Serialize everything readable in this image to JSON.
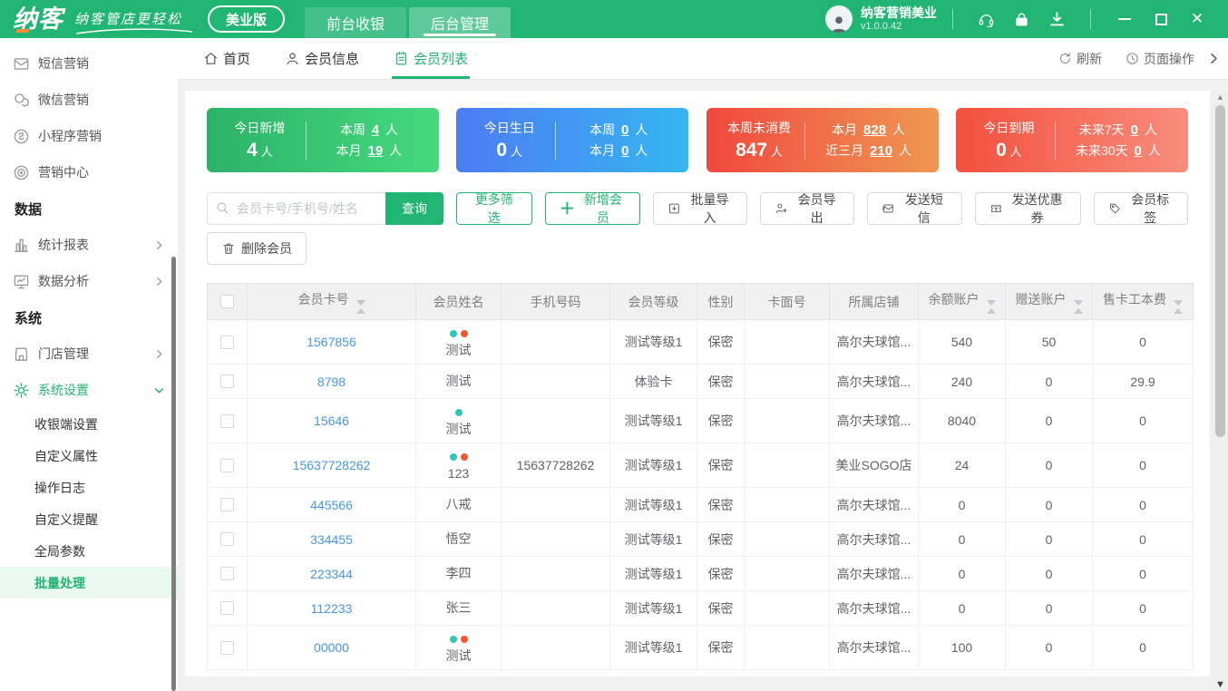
{
  "colors": {
    "brand_green": "#21b573",
    "link_blue": "#4596e8",
    "tag_teal": "#2fc7b2",
    "tag_red": "#f4572e"
  },
  "app": {
    "logo_text": "纳客",
    "slogan": "纳客管店更轻松",
    "edition": "美业版",
    "nav": [
      {
        "label": "前台收银"
      },
      {
        "label": "后台管理"
      }
    ],
    "user_name": "纳客营销美业",
    "version": "v1.0.0.42"
  },
  "tabbar": {
    "tabs": [
      {
        "label": "首页"
      },
      {
        "label": "会员信息"
      },
      {
        "label": "会员列表"
      }
    ],
    "refresh": "刷新",
    "page_actions": "页面操作"
  },
  "sidebar": {
    "items": [
      {
        "label": "短信营销",
        "icon": "mail-icon",
        "type": "item"
      },
      {
        "label": "微信营销",
        "icon": "wechat-icon",
        "type": "item"
      },
      {
        "label": "小程序营销",
        "icon": "miniapp-icon",
        "type": "item"
      },
      {
        "label": "营销中心",
        "icon": "target-icon",
        "type": "item"
      },
      {
        "label": "数据",
        "type": "section"
      },
      {
        "label": "统计报表",
        "icon": "bar-chart-icon",
        "type": "item",
        "chevron": true
      },
      {
        "label": "数据分析",
        "icon": "monitor-icon",
        "type": "item",
        "chevron": true
      },
      {
        "label": "系统",
        "type": "section"
      },
      {
        "label": "门店管理",
        "icon": "store-icon",
        "type": "item",
        "chevron": true
      },
      {
        "label": "系统设置",
        "icon": "gear-icon",
        "type": "item",
        "expanded": true,
        "active": true
      },
      {
        "label": "收银端设置",
        "type": "subitem"
      },
      {
        "label": "自定义属性",
        "type": "subitem"
      },
      {
        "label": "操作日志",
        "type": "subitem"
      },
      {
        "label": "自定义提醒",
        "type": "subitem"
      },
      {
        "label": "全局参数",
        "type": "subitem"
      },
      {
        "label": "批量处理",
        "type": "subitem",
        "active": true
      }
    ]
  },
  "stat_cards": [
    {
      "title": "今日新增",
      "value": "4",
      "unit": "人",
      "color": "green",
      "stats": [
        {
          "label": "本周",
          "value": "4",
          "unit": "人"
        },
        {
          "label": "本月",
          "value": "19",
          "unit": "人"
        }
      ]
    },
    {
      "title": "今日生日",
      "value": "0",
      "unit": "人",
      "color": "blue",
      "stats": [
        {
          "label": "本周",
          "value": "0",
          "unit": "人"
        },
        {
          "label": "本月",
          "value": "0",
          "unit": "人"
        }
      ]
    },
    {
      "title": "本周未消费",
      "value": "847",
      "unit": "人",
      "color": "orange",
      "stats": [
        {
          "label": "本月",
          "value": "828",
          "unit": "人"
        },
        {
          "label": "近三月",
          "value": "210",
          "unit": "人"
        }
      ]
    },
    {
      "title": "今日到期",
      "value": "0",
      "unit": "人",
      "color": "red",
      "stats": [
        {
          "label": "未来7天",
          "value": "0",
          "unit": "人"
        },
        {
          "label": "未来30天",
          "value": "0",
          "unit": "人"
        }
      ]
    }
  ],
  "toolbar": {
    "search_placeholder": "会员卡号/手机号/姓名",
    "query": "查询",
    "more_filter": "更多筛选",
    "add_plus": "＋",
    "add_member": "新增会员",
    "batch_import": "批量导入",
    "member_export": "会员导出",
    "send_sms": "发送短信",
    "send_coupon": "发送优惠券",
    "member_tag": "会员标签",
    "delete_member": "删除会员"
  },
  "table": {
    "columns": [
      {
        "label": "",
        "type": "checkbox"
      },
      {
        "label": "会员卡号",
        "sortable": true
      },
      {
        "label": "会员姓名"
      },
      {
        "label": "手机号码"
      },
      {
        "label": "会员等级"
      },
      {
        "label": "性别"
      },
      {
        "label": "卡面号"
      },
      {
        "label": "所属店铺"
      },
      {
        "label": "余额账户",
        "sortable": true
      },
      {
        "label": "赠送账户",
        "sortable": true
      },
      {
        "label": "售卡工本费",
        "sortable": true
      }
    ],
    "rows": [
      {
        "card_no": "1567856",
        "name": "测试",
        "tags": [
          "teal",
          "red"
        ],
        "phone": "",
        "level": "测试等级1",
        "gender": "保密",
        "card_face": "",
        "store": "高尔夫球馆...",
        "balance": "540",
        "gift": "50",
        "fee": "0"
      },
      {
        "card_no": "8798",
        "name": "测试",
        "tags": [],
        "phone": "",
        "level": "体验卡",
        "gender": "保密",
        "card_face": "",
        "store": "高尔夫球馆...",
        "balance": "240",
        "gift": "0",
        "fee": "29.9"
      },
      {
        "card_no": "15646",
        "name": "测试",
        "tags": [
          "teal"
        ],
        "phone": "",
        "level": "测试等级1",
        "gender": "保密",
        "card_face": "",
        "store": "高尔夫球馆...",
        "balance": "8040",
        "gift": "0",
        "fee": "0"
      },
      {
        "card_no": "15637728262",
        "name": "123",
        "tags": [
          "teal",
          "red"
        ],
        "phone": "15637728262",
        "level": "测试等级1",
        "gender": "保密",
        "card_face": "",
        "store": "美业SOGO店",
        "balance": "24",
        "gift": "0",
        "fee": "0"
      },
      {
        "card_no": "445566",
        "name": "八戒",
        "tags": [],
        "phone": "",
        "level": "测试等级1",
        "gender": "保密",
        "card_face": "",
        "store": "高尔夫球馆...",
        "balance": "0",
        "gift": "0",
        "fee": "0"
      },
      {
        "card_no": "334455",
        "name": "悟空",
        "tags": [],
        "phone": "",
        "level": "测试等级1",
        "gender": "保密",
        "card_face": "",
        "store": "高尔夫球馆...",
        "balance": "0",
        "gift": "0",
        "fee": "0"
      },
      {
        "card_no": "223344",
        "name": "李四",
        "tags": [],
        "phone": "",
        "level": "测试等级1",
        "gender": "保密",
        "card_face": "",
        "store": "高尔夫球馆...",
        "balance": "0",
        "gift": "0",
        "fee": "0"
      },
      {
        "card_no": "112233",
        "name": "张三",
        "tags": [],
        "phone": "",
        "level": "测试等级1",
        "gender": "保密",
        "card_face": "",
        "store": "高尔夫球馆...",
        "balance": "0",
        "gift": "0",
        "fee": "0"
      },
      {
        "card_no": "00000",
        "name": "测试",
        "tags": [
          "teal",
          "red"
        ],
        "phone": "",
        "level": "测试等级1",
        "gender": "保密",
        "card_face": "",
        "store": "高尔夫球馆...",
        "balance": "100",
        "gift": "0",
        "fee": "0"
      }
    ]
  }
}
